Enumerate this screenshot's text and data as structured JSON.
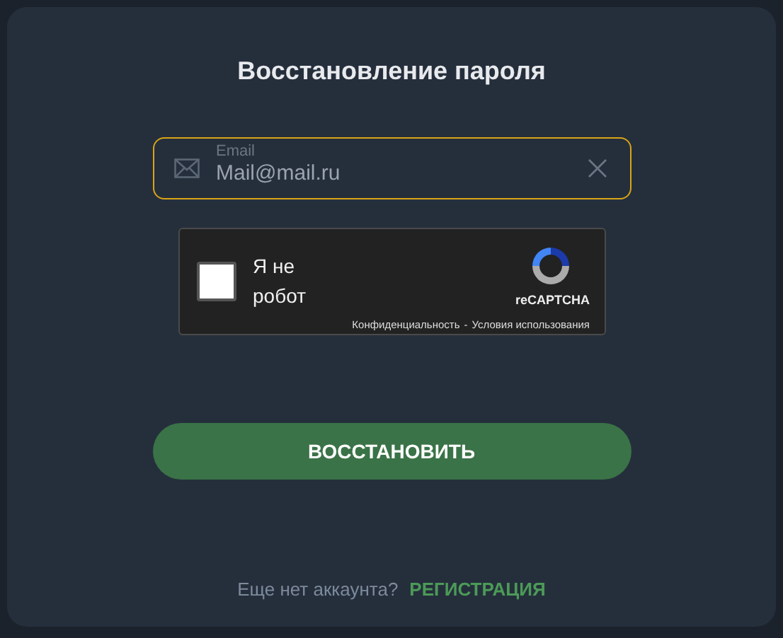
{
  "title": "Восстановление пароля",
  "email_field": {
    "label": "Email",
    "value": "Mail@mail.ru",
    "focused": true
  },
  "captcha": {
    "label": "Я не робот",
    "checked": false,
    "brand": "reCAPTCHA",
    "privacy": "Конфиденциальность",
    "separator": "-",
    "terms": "Условия использования"
  },
  "submit_button": "ВОССТАНОВИТЬ",
  "footer": {
    "question": "Еще нет аккаунта?",
    "link": "РЕГИСТРАЦИЯ"
  }
}
